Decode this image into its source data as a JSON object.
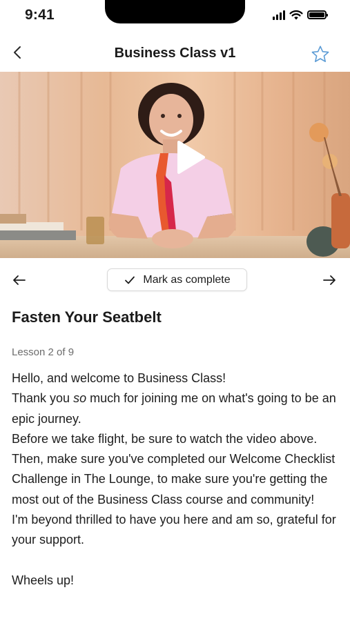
{
  "status_bar": {
    "time": "9:41"
  },
  "header": {
    "title": "Business Class v1"
  },
  "lesson_nav": {
    "mark_complete_label": "Mark as complete"
  },
  "lesson": {
    "title": "Fasten Your Seatbelt",
    "count": "Lesson 2 of 9",
    "paragraphs": {
      "p1": "Hello, and welcome to Business Class!",
      "p2_before": "Thank you ",
      "p2_emph": "so",
      "p2_after": " much for joining me on what's going to be an epic journey.",
      "p3": "Before we take flight, be sure to watch the video above. Then, make sure you've completed our Welcome Checklist Challenge in The Lounge, to make sure you're getting the most out of the Business Class course and community!",
      "p4": "I'm beyond thrilled to have you here and am so, grateful for your support.",
      "p5": "Wheels up!"
    }
  },
  "colors": {
    "accent_star": "#5b9bd5",
    "text": "#1b1b1b",
    "muted": "#6b6b6b"
  },
  "icons": {
    "back": "chevron-left-icon",
    "favorite": "star-outline-icon",
    "play": "play-icon",
    "prev": "arrow-left-icon",
    "next": "arrow-right-icon",
    "check": "check-icon"
  }
}
